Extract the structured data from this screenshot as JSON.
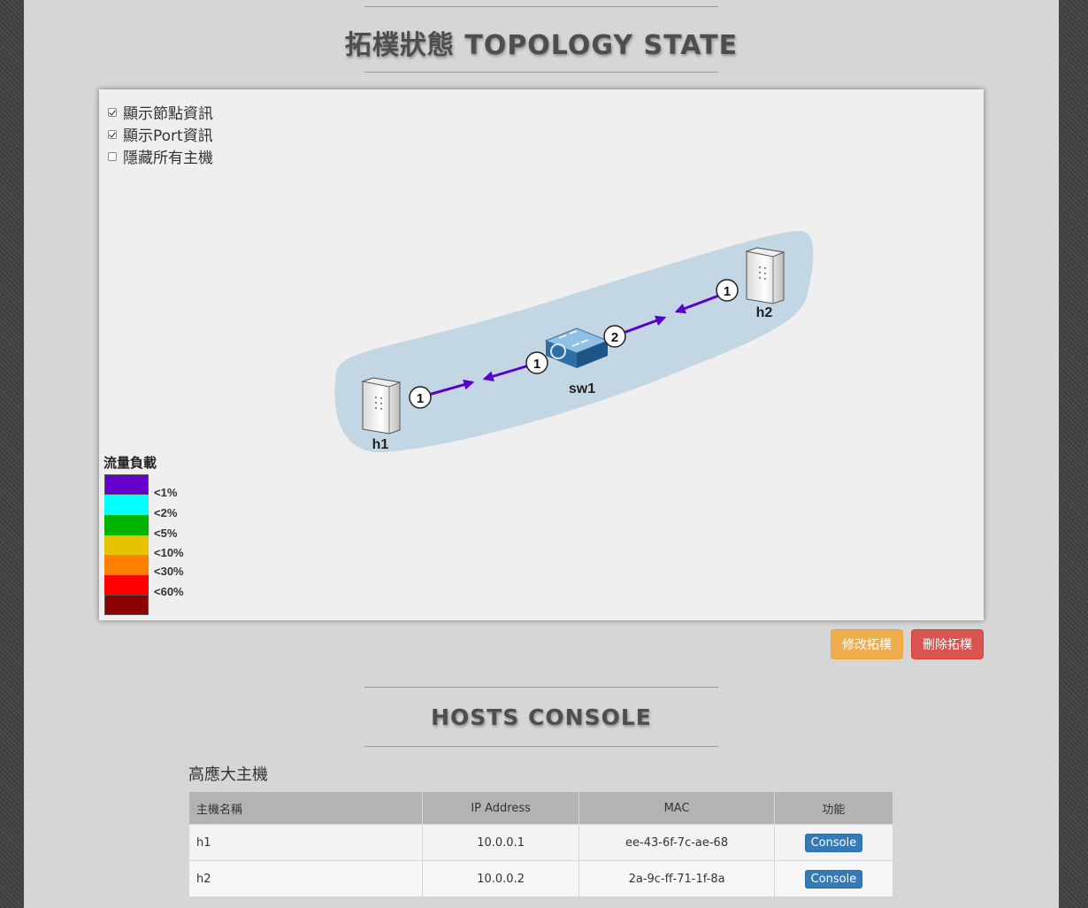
{
  "topology": {
    "title": "拓樸狀態 TOPOLOGY STATE",
    "options": [
      {
        "label": "顯示節點資訊",
        "checked": true
      },
      {
        "label": "顯示Port資訊",
        "checked": true
      },
      {
        "label": "隱藏所有主機",
        "checked": false
      }
    ],
    "nodes": {
      "h1": "h1",
      "h2": "h2",
      "sw1": "sw1"
    },
    "ports": {
      "h1_port": "1",
      "sw1_port_left": "1",
      "sw1_port_right": "2",
      "h2_port": "1"
    },
    "legend": {
      "title": "流量負載",
      "items": [
        {
          "label": "<1%",
          "color": "#6600cc"
        },
        {
          "label": "<2%",
          "color": "#00ffff"
        },
        {
          "label": "<5%",
          "color": "#00b300"
        },
        {
          "label": "<10%",
          "color": "#e6c200"
        },
        {
          "label": "<30%",
          "color": "#ff8000"
        },
        {
          "label": "<60%",
          "color": "#ff0000"
        },
        {
          "label": "",
          "color": "#8b0000"
        }
      ]
    },
    "buttons": {
      "edit": "修改拓樸",
      "delete": "刪除拓樸"
    }
  },
  "hosts": {
    "title": "HOSTS CONSOLE",
    "subtitle": "高應大主機",
    "columns": [
      "主機名稱",
      "IP Address",
      "MAC",
      "功能"
    ],
    "rows": [
      {
        "name": "h1",
        "ip": "10.0.0.1",
        "mac": "ee-43-6f-7c-ae-68",
        "action": "Console"
      },
      {
        "name": "h2",
        "ip": "10.0.0.2",
        "mac": "2a-9c-ff-71-1f-8a",
        "action": "Console"
      }
    ]
  }
}
